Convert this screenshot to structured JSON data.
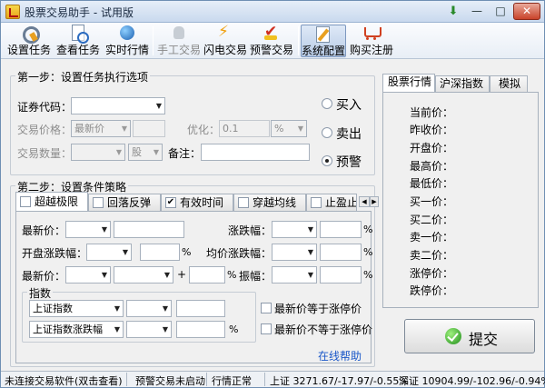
{
  "window": {
    "title": "股票交易助手 - 试用版",
    "controls": {
      "update": "⬇",
      "min": "—",
      "max": "□",
      "close": "✕"
    }
  },
  "toolbar": {
    "items": [
      {
        "label": "设置任务",
        "icon": "gear-task-icon",
        "enabled": true,
        "active": false
      },
      {
        "label": "查看任务",
        "icon": "view-task-icon",
        "enabled": true,
        "active": false
      },
      {
        "label": "实时行情",
        "icon": "globe-icon",
        "enabled": true,
        "active": false
      },
      {
        "label": "手工交易",
        "icon": "hand-icon",
        "enabled": false,
        "active": false
      },
      {
        "label": "闪电交易",
        "icon": "lightning-icon",
        "enabled": true,
        "active": false
      },
      {
        "label": "预警交易",
        "icon": "alert-check-icon",
        "enabled": true,
        "active": false
      },
      {
        "label": "系统配置",
        "icon": "config-pencil-icon",
        "enabled": true,
        "active": true
      },
      {
        "label": "购买注册",
        "icon": "cart-icon",
        "enabled": true,
        "active": false
      }
    ]
  },
  "step1": {
    "title": "第一步：设置任务执行选项",
    "code_label": "证券代码：",
    "code_value": "",
    "price_label": "交易价格：",
    "price_mode": "最新价",
    "price_value": "",
    "optimize_label": "优化：",
    "optimize_value": "0.1",
    "optimize_unit": "%",
    "qty_label": "交易数量：",
    "qty_value": "",
    "qty_unit": "股",
    "note_label": "备注：",
    "note_value": "",
    "actions": [
      {
        "label": "买入",
        "selected": false
      },
      {
        "label": "卖出",
        "selected": false
      },
      {
        "label": "预警",
        "selected": true
      }
    ]
  },
  "step2": {
    "title": "第二步：设置条件策略",
    "tabs": [
      {
        "label": "超越极限",
        "checked": false,
        "selected": true
      },
      {
        "label": "回落反弹",
        "checked": false,
        "selected": false
      },
      {
        "label": "有效时间",
        "checked": true,
        "selected": false
      },
      {
        "label": "穿越均线",
        "checked": false,
        "selected": false
      },
      {
        "label": "止盈止损",
        "checked": false,
        "selected": false
      }
    ],
    "row1": {
      "left_label": "最新价：",
      "right_label": "涨跌幅：",
      "unit": "%"
    },
    "row2": {
      "left_label": "开盘涨跌幅：",
      "left_unit": "%",
      "right_label": "均价涨跌幅：",
      "right_unit": "%"
    },
    "row3": {
      "left_label": "最新价：",
      "plus": "+",
      "mid_unit": "%",
      "right_label": "振幅：",
      "right_unit": "%"
    },
    "index_group": {
      "title": "指数",
      "rows": [
        {
          "name": "上证指数",
          "unit": ""
        },
        {
          "name": "上证指数涨跌幅",
          "unit": "%"
        }
      ]
    },
    "checks": [
      {
        "label": "最新价等于涨停价",
        "checked": false
      },
      {
        "label": "最新价不等于涨停价",
        "checked": false
      }
    ],
    "help_link": "在线帮助"
  },
  "right_panel": {
    "tabs": [
      {
        "label": "股票行情",
        "selected": true
      },
      {
        "label": "沪深指数",
        "selected": false
      },
      {
        "label": "模拟",
        "selected": false
      }
    ],
    "fields": [
      "当前价：",
      "昨收价：",
      "开盘价：",
      "最高价：",
      "最低价：",
      "买一价：",
      "买二价：",
      "卖一价：",
      "卖二价：",
      "涨停价：",
      "跌停价："
    ],
    "submit_label": "提交"
  },
  "status": {
    "conn": "未连接交易软件(双击查看)",
    "alert": "预警交易未启动",
    "market": "行情正常",
    "sh": "上证 3271.67/-17.97/-0.55%",
    "sz": "深证 10904.99/-102.96/-0.94%"
  }
}
